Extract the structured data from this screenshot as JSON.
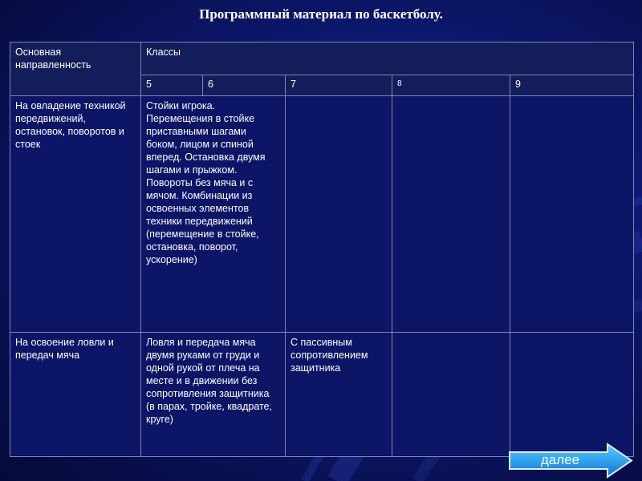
{
  "slide": {
    "title": "Программный материал по баскетболу."
  },
  "table": {
    "header": {
      "direction": "Основная направленность",
      "classes": "Классы",
      "grades": [
        "5",
        "6",
        "7",
        "8",
        "9"
      ]
    },
    "rows": [
      {
        "direction": "На овладение техникой передвижений, остановок, поворотов и стоек",
        "cells": [
          "Стойки игрока. Перемещения в стойке приставными шагами боком, лицом и спиной вперед. Остановка двумя шагами и прыжком. Повороты без мяча и с мячом. Комбинации из освоенных элементов техники передвижений (перемещение в стойке, остановка, поворот, ускорение)",
          "",
          "",
          ""
        ]
      },
      {
        "direction": "На освоение ловли и передач мяча",
        "cells": [
          "Ловля и передача мяча двумя руками от груди и одной рукой от плеча на месте и в движении без сопротивления защитника (в парах, тройке, квадрате, круге)",
          "С пассивным сопротивлением защитника",
          "",
          ""
        ]
      }
    ]
  },
  "navigation": {
    "next_label": "далее",
    "next_icon": "arrow-right-icon",
    "button_color": "#2fa3f0"
  }
}
